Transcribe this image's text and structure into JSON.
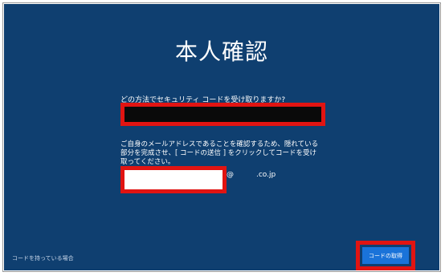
{
  "page": {
    "title": "本人確認"
  },
  "method": {
    "question": "どの方法でセキュリティ コードを受け取りますか?",
    "selected_value": ""
  },
  "email": {
    "description": "ご自身のメールアドレスであることを確認するため、隠れている部分を完成させ、[ コードの送信 ] をクリックしてコードを受け取ってください。",
    "input_value": "",
    "at_symbol": "@",
    "domain_suffix": ".co.jp"
  },
  "footer": {
    "no_code_link": "コードを持っている場合",
    "get_code_button": "コードの取得"
  }
}
